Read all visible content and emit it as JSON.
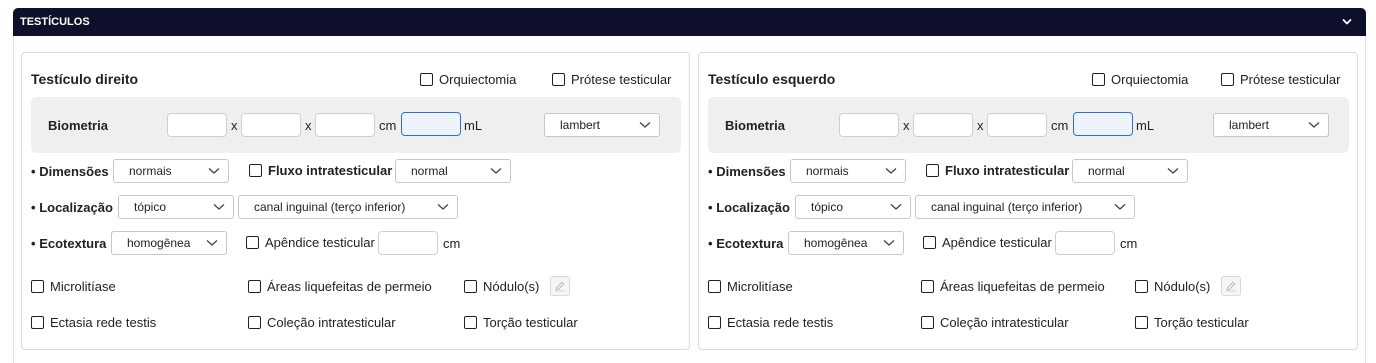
{
  "section": {
    "title": "TESTÍCULOS"
  },
  "panels": [
    {
      "title": "Testículo direito",
      "orquiectomia": "Orquiectomia",
      "protese": "Prótese testicular",
      "biometria": {
        "label": "Biometria",
        "sep1": "x",
        "sep2": "x",
        "unit_cm": "cm",
        "unit_ml": "mL",
        "method": "lambert"
      },
      "dimensoes": {
        "label": "Dimensões",
        "value": "normais"
      },
      "fluxo": {
        "label": "Fluxo intratesticular",
        "value": "normal"
      },
      "localizacao": {
        "label": "Localização",
        "value": "tópico",
        "sub_value": "canal inguinal (terço inferior)"
      },
      "ecotextura": {
        "label": "Ecotextura",
        "value": "homogênea"
      },
      "apendice": {
        "label": "Apêndice testicular",
        "unit": "cm"
      },
      "checks": {
        "microlitiase": "Microlitíase",
        "areas": "Áreas liquefeitas de permeio",
        "nodulos": "Nódulo(s)",
        "ectasia": "Ectasia rede testis",
        "colecao": "Coleção intratesticular",
        "torcao": "Torção testicular"
      }
    },
    {
      "title": "Testículo esquerdo",
      "orquiectomia": "Orquiectomia",
      "protese": "Prótese testicular",
      "biometria": {
        "label": "Biometria",
        "sep1": "x",
        "sep2": "x",
        "unit_cm": "cm",
        "unit_ml": "mL",
        "method": "lambert"
      },
      "dimensoes": {
        "label": "Dimensões",
        "value": "normais"
      },
      "fluxo": {
        "label": "Fluxo intratesticular",
        "value": "normal"
      },
      "localizacao": {
        "label": "Localização",
        "value": "tópico",
        "sub_value": "canal inguinal (terço inferior)"
      },
      "ecotextura": {
        "label": "Ecotextura",
        "value": "homogênea"
      },
      "apendice": {
        "label": "Apêndice testicular",
        "unit": "cm"
      },
      "checks": {
        "microlitiase": "Microlitíase",
        "areas": "Áreas liquefeitas de permeio",
        "nodulos": "Nódulo(s)",
        "ectasia": "Ectasia rede testis",
        "colecao": "Coleção intratesticular",
        "torcao": "Torção testicular"
      }
    }
  ],
  "icons": {
    "collapse": "chevron-down-icon",
    "select_caret": "chevron-down-icon",
    "edit": "pencil-icon"
  },
  "colors": {
    "header_bg": "#0d0f2b",
    "focus_border": "#2f6fd1",
    "biometria_bg": "#efefef"
  }
}
